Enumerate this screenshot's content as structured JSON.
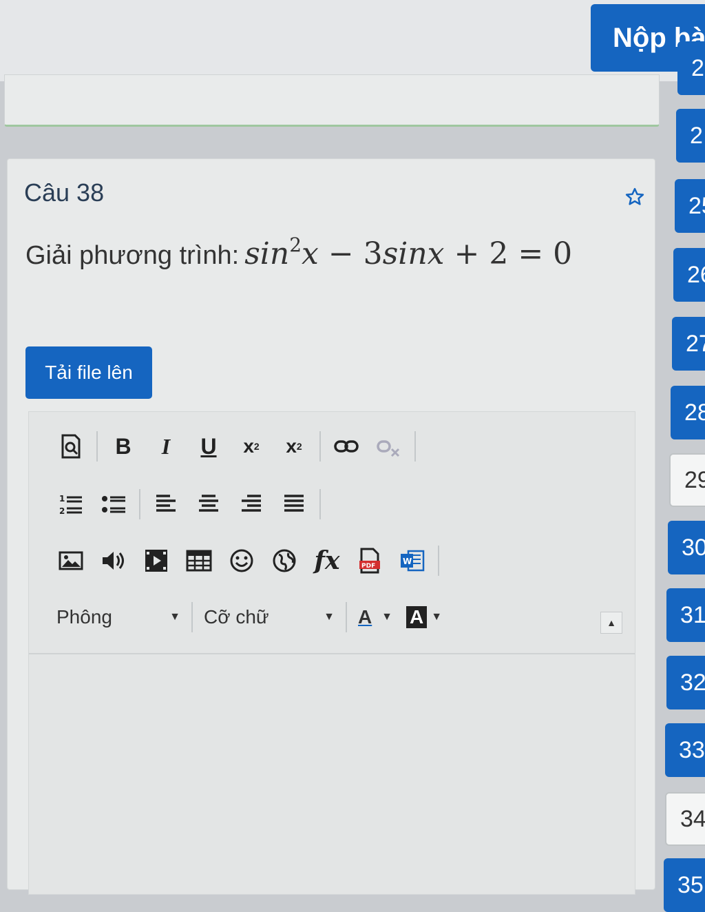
{
  "header": {
    "submit_label": "Nộp bài"
  },
  "question": {
    "title": "Câu 38",
    "prompt": "Giải phương trình:",
    "equation": {
      "a": "sin",
      "exp": "2",
      "b": "x",
      "c": " − 3",
      "d": "sinx",
      "e": " + 2 = 0"
    }
  },
  "upload": {
    "label": "Tải file lên"
  },
  "editor": {
    "font_label": "Phông",
    "size_label": "Cỡ chữ",
    "text_color_label": "A",
    "bg_color_label": "A",
    "icons": [
      "preview-icon",
      "bold-icon",
      "italic-icon",
      "underline-icon",
      "subscript-icon",
      "superscript-icon",
      "link-icon",
      "unlink-icon",
      "numbered-list-icon",
      "bullet-list-icon",
      "align-left-icon",
      "align-center-icon",
      "align-right-icon",
      "justify-icon",
      "image-icon",
      "audio-icon",
      "video-icon",
      "table-icon",
      "emoji-icon",
      "globe-icon",
      "formula-icon",
      "pdf-icon",
      "word-icon"
    ]
  },
  "nav": {
    "items": [
      {
        "label": "2",
        "state": "filled"
      },
      {
        "label": "2",
        "state": "filled"
      },
      {
        "label": "25",
        "state": "filled"
      },
      {
        "label": "26",
        "state": "filled"
      },
      {
        "label": "27",
        "state": "filled"
      },
      {
        "label": "28",
        "state": "filled"
      },
      {
        "label": "29",
        "state": "empty"
      },
      {
        "label": "30",
        "state": "filled"
      },
      {
        "label": "31",
        "state": "filled"
      },
      {
        "label": "32",
        "state": "filled"
      },
      {
        "label": "33",
        "state": "filled"
      },
      {
        "label": "34",
        "state": "empty"
      },
      {
        "label": "35",
        "state": "filled"
      }
    ]
  },
  "colors": {
    "primary": "#1565c0",
    "card_bg": "#e8eaea",
    "text_color_underline": "#1565c0"
  }
}
